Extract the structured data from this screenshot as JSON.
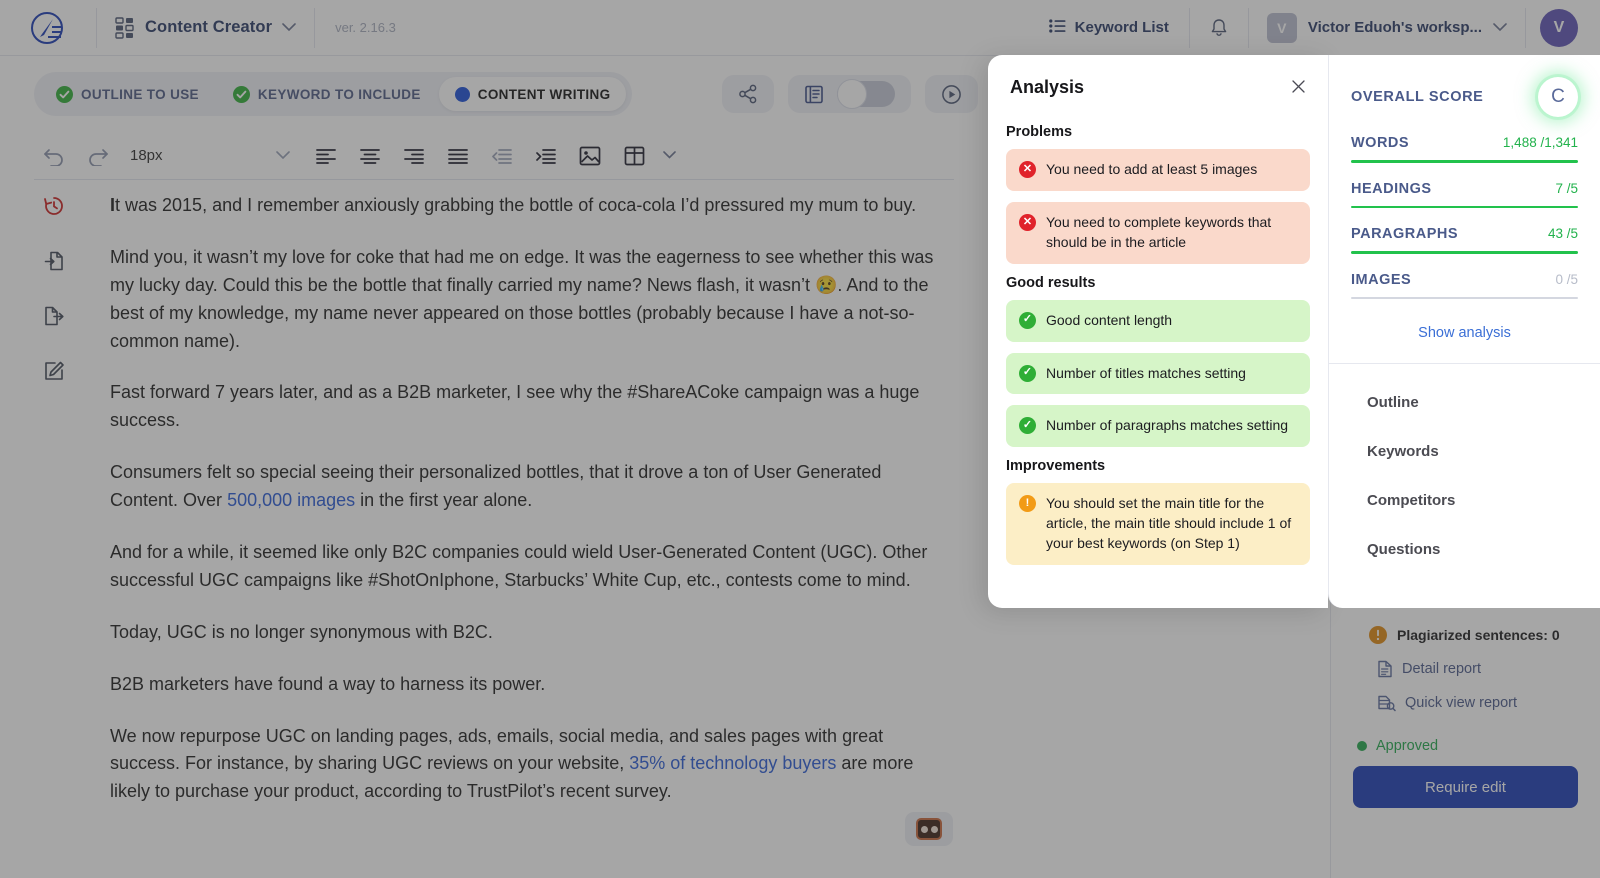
{
  "topbar": {
    "logo_icon": "pen-circle-logo",
    "grid_icon": "grid-menu-icon",
    "app_name": "Content Creator",
    "app_chevron_icon": "chevron-down-icon",
    "version": "ver. 2.16.3",
    "keyword_list_icon": "list-icon",
    "keyword_list_label": "Keyword List",
    "bell_icon": "bell-icon",
    "workspace_initial": "V",
    "workspace_name": "Victor Eduoh's worksp...",
    "workspace_chevron_icon": "chevron-down-icon",
    "avatar_initial": "V"
  },
  "steps": [
    {
      "label": "OUTLINE TO USE",
      "state": "done",
      "icon": "check-circle-icon"
    },
    {
      "label": "KEYWORD TO INCLUDE",
      "state": "done",
      "icon": "check-circle-icon"
    },
    {
      "label": "CONTENT WRITING",
      "state": "active",
      "icon": "filled-dot-icon"
    }
  ],
  "editor_actions": {
    "share_icon": "share-icon",
    "book_icon": "book-icon",
    "toggle_state": "off",
    "play_icon": "play-circle-icon"
  },
  "format_toolbar": {
    "undo_icon": "undo-icon",
    "redo_icon": "redo-icon",
    "font_size": "18px",
    "font_size_chevron_icon": "chevron-down-icon",
    "align_left_icon": "align-left-icon",
    "align_center_icon": "align-center-icon",
    "align_right_icon": "align-right-icon",
    "align_justify_icon": "align-justify-icon",
    "outdent_icon": "outdent-icon",
    "indent_icon": "indent-icon",
    "image_icon": "image-icon",
    "table_icon": "table-icon",
    "table_chevron_icon": "chevron-down-icon"
  },
  "left_rail": [
    {
      "icon": "history-revert-icon"
    },
    {
      "icon": "import-document-icon"
    },
    {
      "icon": "export-document-icon"
    },
    {
      "icon": "edit-document-icon"
    }
  ],
  "document": {
    "paragraphs": [
      {
        "lead": "I",
        "text": "t was 2015, and I remember anxiously grabbing the bottle of coca-cola I’d pressured my mum to buy."
      },
      {
        "text": "Mind you, it wasn’t my love for coke that had me on edge. It was the eagerness to see whether this was my lucky day. Could this be the bottle that finally carried my name? News flash, it wasn’t 😢. And to the best of my knowledge, my name never appeared on those bottles (probably because I have a not-so-common name)."
      },
      {
        "text": "Fast forward 7 years later, and as a B2B marketer, I see why the #ShareACoke campaign was a huge success."
      },
      {
        "text": "Consumers felt so special seeing their personalized bottles, that it drove a ton of User Generated Content. Over ",
        "link": "500,000 images",
        "text_after": " in the first year alone."
      },
      {
        "text": "And for a while, it seemed like only B2C companies could wield User-Generated Content (UGC). Other successful UGC campaigns like #ShotOnIphone, Starbucks’ White Cup, etc., contests come to mind."
      },
      {
        "text": "Today, UGC is no longer synonymous with B2C."
      },
      {
        "text": "B2B marketers have found a way to harness its power."
      },
      {
        "text": "We now repurpose UGC on landing pages, ads, emails, social media, and sales pages with great success. For instance, by sharing UGC reviews on your website, ",
        "link": "35% of technology buyers",
        "text_after": " are more likely to purchase your product, according to TrustPilot’s recent survey."
      }
    ],
    "mini_badge_icon": "media-badge-icon"
  },
  "analysis_modal": {
    "title": "Analysis",
    "close_icon": "close-icon",
    "sections": [
      {
        "heading": "Problems",
        "kind": "bad",
        "icon": "error-circle-icon",
        "glyph": "✕",
        "items": [
          "You need to add at least 5 images",
          "You need to complete keywords that should be in the article"
        ]
      },
      {
        "heading": "Good results",
        "kind": "good",
        "icon": "check-circle-icon",
        "glyph": "✓",
        "items": [
          "Good content length",
          "Number of titles matches setting",
          "Number of paragraphs matches setting"
        ]
      },
      {
        "heading": "Improvements",
        "kind": "warn",
        "icon": "warning-circle-icon",
        "glyph": "!",
        "items": [
          "You should set the main title for the article, the main title should include 1 of your best keywords (on Step 1)"
        ]
      }
    ]
  },
  "sidebar": {
    "overall_score_label": "OVERALL SCORE",
    "overall_score_grade": "C",
    "metrics": [
      {
        "name": "WORDS",
        "value": "1,488 /1,341",
        "state": "ok"
      },
      {
        "name": "HEADINGS",
        "value": "7 /5",
        "state": "ok"
      },
      {
        "name": "PARAGRAPHS",
        "value": "43 /5",
        "state": "ok"
      },
      {
        "name": "IMAGES",
        "value": "0 /5",
        "state": "empty"
      }
    ],
    "show_analysis_label": "Show analysis",
    "menu": [
      {
        "label": "Outline"
      },
      {
        "label": "Keywords"
      },
      {
        "label": "Competitors"
      },
      {
        "label": "Questions"
      }
    ],
    "plagiarism": {
      "icon": "warning-circle-icon",
      "label": "Plagiarized sentences: 0",
      "detail_report_icon": "document-icon",
      "detail_report_label": "Detail report",
      "quick_view_icon": "document-search-icon",
      "quick_view_label": "Quick view report"
    },
    "status_label": "Approved",
    "require_edit_label": "Require edit"
  },
  "colors": {
    "brand_blue": "#1b3bb5",
    "accent_blue": "#2a5bd7",
    "good_green": "#22b24c",
    "bad_red": "#e0232b",
    "warn_orange": "#f29b16",
    "nav_text": "#2a3a66"
  }
}
